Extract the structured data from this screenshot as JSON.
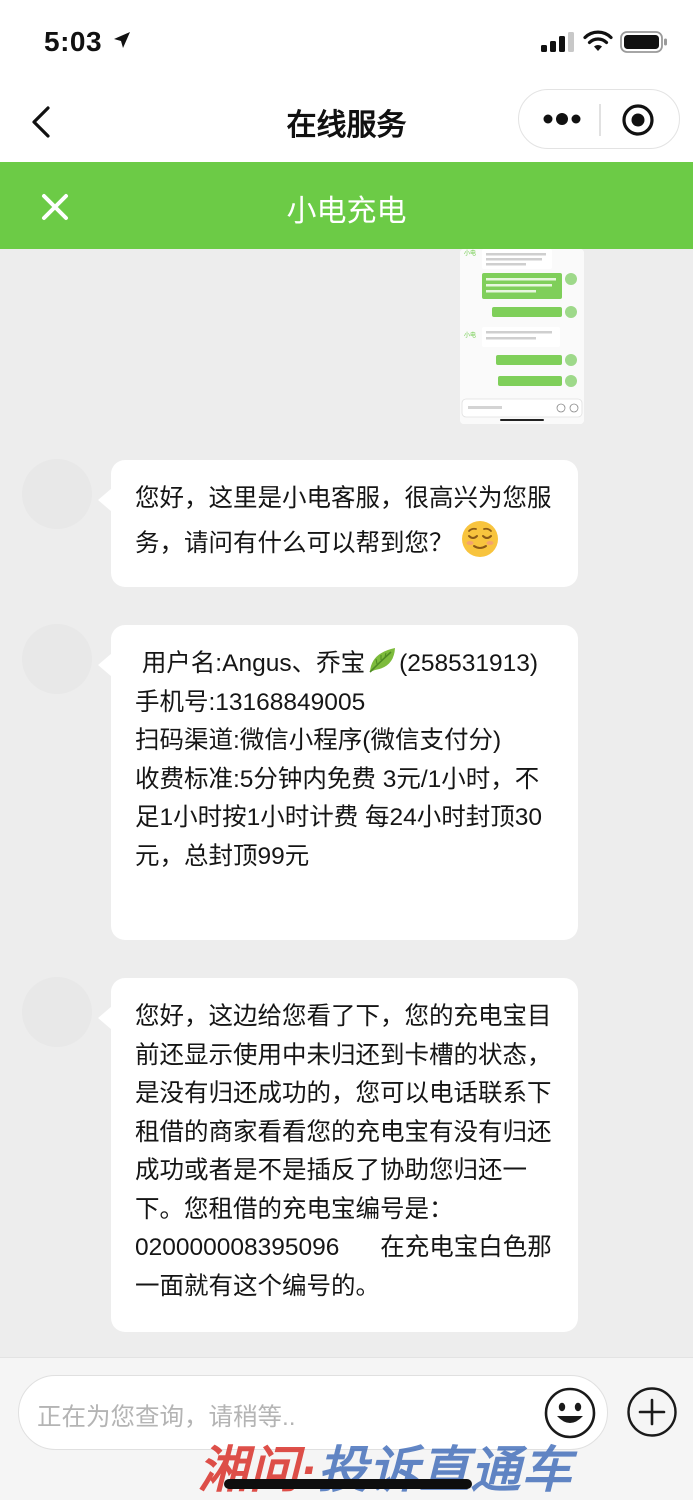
{
  "status_bar": {
    "time": "5:03"
  },
  "nav": {
    "title": "在线服务"
  },
  "header": {
    "title": "小电充电"
  },
  "messages": [
    {
      "text": "您好，这里是小电客服，很高兴为您服务，请问有什么可以帮到您？",
      "emoji": "relieved-face"
    },
    {
      "text": " 用户名:Angus、乔宝",
      "text2": "(258531913)\n手机号:13168849005\n扫码渠道:微信小程序(微信支付分)\n收费标准:5分钟内免费 3元/1小时，不足1小时按1小时计费 每24小时封顶30元，总封顶99元",
      "emoji": "leaf"
    },
    {
      "text": "您好，这边给您看了下，您的充电宝目前还显示使用中未归还到卡槽的状态，是没有归还成功的，您可以电话联系下租借的商家看看您的充电宝有没有归还成功或者是不是插反了协助您归还一下。您租借的充电宝编号是：020000008395096      在充电宝白色那一面就有这个编号的。"
    }
  ],
  "input": {
    "placeholder": "正在为您查询，请稍等.."
  },
  "watermark": {
    "part1": "湘问·",
    "part2": "投诉直通车"
  },
  "colors": {
    "header_green": "#6ccb46",
    "background": "#ededed"
  }
}
